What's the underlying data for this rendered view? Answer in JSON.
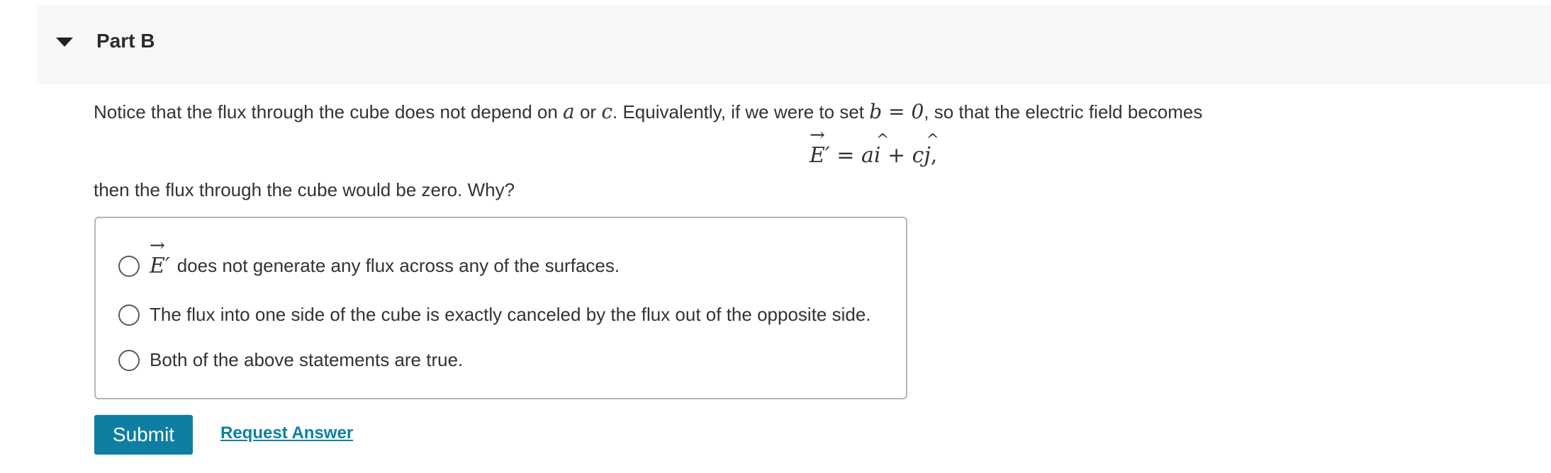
{
  "part": {
    "title": "Part B"
  },
  "question": {
    "prompt_1": "Notice that the flux through the cube does not depend on ",
    "var_a": "a",
    "prompt_or": " or ",
    "var_c": "c",
    "prompt_2": ". Equivalently, if we were to set ",
    "var_b": "b",
    "eq_zero": " = 0",
    "prompt_3": ", so that the electric field becomes",
    "equation": {
      "field": "E′",
      "equals": " = ",
      "a": "a",
      "i_hat": "i",
      "plus": " + ",
      "c": "c",
      "j_hat": "j",
      "comma": ","
    },
    "followup": "then the flux through the cube would be zero. Why?"
  },
  "choices": {
    "option_1_math": "E′",
    "option_1_text": "does not generate any flux across any of the surfaces.",
    "option_2_text": "The flux into one side of the cube is exactly canceled by the flux out of the opposite side.",
    "option_3_text": "Both of the above statements are true."
  },
  "actions": {
    "submit_label": "Submit",
    "request_answer_label": "Request Answer"
  },
  "colors": {
    "accent": "#0e7fa3",
    "header_bg": "#f7f7f7",
    "text": "#333333"
  },
  "icons": {
    "collapse": "caret-down-icon",
    "radio": "radio-button-icon"
  }
}
